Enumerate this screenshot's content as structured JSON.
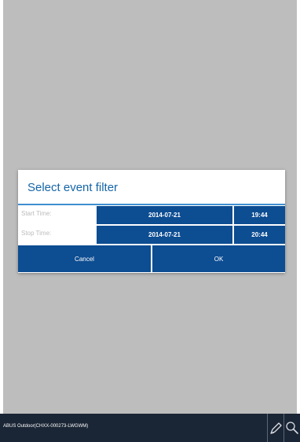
{
  "dialog": {
    "title": "Select event filter",
    "start": {
      "label": "Start Time:",
      "date": "2014-07-21",
      "time": "19:44"
    },
    "stop": {
      "label": "Stop Time:",
      "date": "2014-07-21",
      "time": "20:44"
    },
    "cancel_label": "Cancel",
    "ok_label": "OK"
  },
  "bottom_bar": {
    "camera_label": "ABUS Outdoor(CHXX-000273-LWGWM)",
    "icons": [
      "pencil-icon",
      "search-icon"
    ]
  },
  "colors": {
    "accent": "#0d4d92",
    "title_text": "#1565a8",
    "divider": "#3f8fd0",
    "bar": "#1a2535",
    "backdrop": "#bdbdbd"
  }
}
